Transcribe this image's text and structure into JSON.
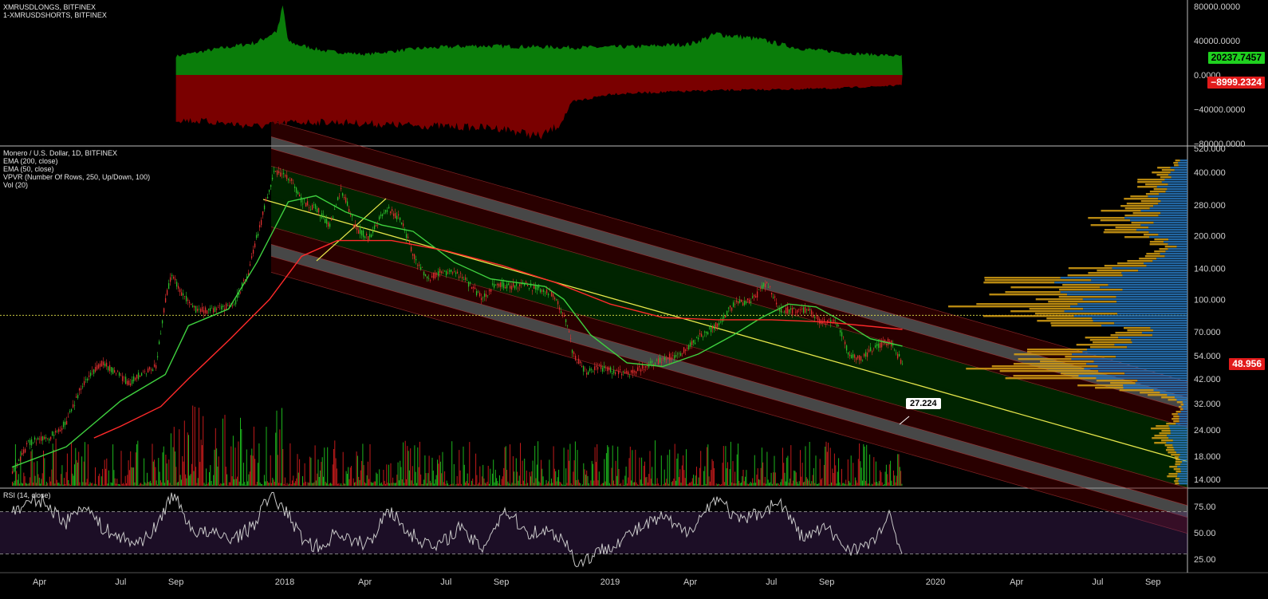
{
  "chart_data": [
    {
      "type": "area",
      "legend": [
        "XMRUSDLONGS, BITFINEX",
        "1-XMRUSDSHORTS, BITFINEX"
      ],
      "y_ticks": [
        "80000.0000",
        "40000.0000",
        "0.0000",
        "−40000.0000",
        "−80000.0000"
      ],
      "ylim": [
        -80000,
        80000
      ],
      "series": [
        {
          "name": "XMRUSDLONGS, BITFINEX",
          "color": "#0a7d0a",
          "last": "20237.7457",
          "x": [
            "2017-09-01",
            "2017-10-15",
            "2017-12-01",
            "2017-12-24",
            "2017-12-30",
            "2018-01-05",
            "2018-02-15",
            "2018-04-01",
            "2018-06-01",
            "2018-08-01",
            "2018-10-01",
            "2018-12-01",
            "2019-02-01",
            "2019-04-01",
            "2019-05-01",
            "2019-06-15",
            "2019-08-01",
            "2019-10-01",
            "2019-11-25"
          ],
          "values": [
            22000,
            30000,
            38000,
            52000,
            80000,
            38000,
            28000,
            24000,
            31000,
            34000,
            33000,
            32000,
            33000,
            36000,
            48000,
            42000,
            31000,
            25000,
            22000
          ]
        },
        {
          "name": "1-XMRUSDSHORTS, BITFINEX",
          "color": "#7a0000",
          "last": "−8999.2324",
          "x": [
            "2017-09-01",
            "2017-10-15",
            "2017-12-01",
            "2018-01-15",
            "2018-03-01",
            "2018-05-01",
            "2018-07-01",
            "2018-09-01",
            "2018-10-15",
            "2018-11-05",
            "2018-11-20",
            "2019-01-01",
            "2019-03-01",
            "2019-05-01",
            "2019-07-01",
            "2019-09-01",
            "2019-11-25"
          ],
          "values": [
            -52000,
            -55000,
            -60000,
            -55000,
            -55000,
            -58000,
            -60000,
            -62000,
            -72000,
            -58000,
            -32000,
            -22000,
            -20000,
            -18000,
            -17000,
            -16000,
            -12000
          ]
        }
      ]
    },
    {
      "type": "line",
      "title": "Monero / U.S. Dollar, 1D, BITFINEX",
      "legend": [
        "EMA (200, close)",
        "EMA (50, close)",
        "VPVR (Number Of Rows, 250, Up/Down, 100)",
        "Vol (20)"
      ],
      "y_scale": "log",
      "y_ticks": [
        "520.000",
        "400.000",
        "280.000",
        "200.000",
        "140.000",
        "100.000",
        "70.000",
        "54.000",
        "42.000",
        "32.000",
        "24.000",
        "18.000",
        "14.000"
      ],
      "x_ticks": [
        "Apr",
        "Jul",
        "Sep",
        "2018",
        "Apr",
        "Jul",
        "Sep",
        "2019",
        "Apr",
        "Jul",
        "Sep",
        "2020",
        "Apr",
        "Jul",
        "Sep"
      ],
      "x_tick_dates": [
        "2017-04-01",
        "2017-07-01",
        "2017-09-01",
        "2018-01-01",
        "2018-04-01",
        "2018-07-01",
        "2018-09-01",
        "2019-01-01",
        "2019-04-01",
        "2019-07-01",
        "2019-09-01",
        "2020-01-01",
        "2020-04-01",
        "2020-07-01",
        "2020-09-01"
      ],
      "last_price": "48.956",
      "horizontal_level": 84,
      "pitchfork_callout": "27.224",
      "price": {
        "x": [
          "2017-03-01",
          "2017-03-20",
          "2017-04-10",
          "2017-05-01",
          "2017-05-20",
          "2017-06-10",
          "2017-06-25",
          "2017-07-10",
          "2017-07-25",
          "2017-08-10",
          "2017-08-26",
          "2017-09-05",
          "2017-09-20",
          "2017-10-05",
          "2017-10-20",
          "2017-11-05",
          "2017-11-20",
          "2017-12-05",
          "2017-12-20",
          "2018-01-05",
          "2018-01-20",
          "2018-02-05",
          "2018-02-20",
          "2018-03-05",
          "2018-03-20",
          "2018-04-05",
          "2018-04-25",
          "2018-05-10",
          "2018-05-25",
          "2018-06-10",
          "2018-06-25",
          "2018-07-10",
          "2018-07-25",
          "2018-08-10",
          "2018-08-25",
          "2018-09-10",
          "2018-09-25",
          "2018-10-10",
          "2018-10-25",
          "2018-11-10",
          "2018-11-20",
          "2018-12-05",
          "2018-12-15",
          "2019-01-01",
          "2019-01-20",
          "2019-02-10",
          "2019-03-01",
          "2019-03-20",
          "2019-04-10",
          "2019-05-01",
          "2019-05-20",
          "2019-06-10",
          "2019-06-25",
          "2019-07-10",
          "2019-07-25",
          "2019-08-10",
          "2019-08-25",
          "2019-09-10",
          "2019-09-25",
          "2019-10-10",
          "2019-10-25",
          "2019-11-10",
          "2019-11-25"
        ],
        "y": [
          15,
          21,
          22,
          26,
          40,
          50,
          45,
          40,
          45,
          48,
          130,
          110,
          90,
          88,
          90,
          95,
          130,
          230,
          400,
          380,
          290,
          270,
          220,
          330,
          220,
          195,
          270,
          240,
          160,
          125,
          135,
          135,
          120,
          100,
          120,
          115,
          118,
          112,
          108,
          84,
          55,
          44,
          48,
          46,
          44,
          48,
          52,
          55,
          66,
          76,
          95,
          100,
          120,
          90,
          88,
          90,
          78,
          80,
          55,
          52,
          60,
          63,
          49
        ]
      },
      "series": [
        {
          "name": "EMA (50, close)",
          "color": "#3fd13f",
          "x": [
            "2017-03-01",
            "2017-05-01",
            "2017-07-01",
            "2017-08-20",
            "2017-09-15",
            "2017-10-30",
            "2017-12-01",
            "2018-01-05",
            "2018-02-05",
            "2018-03-10",
            "2018-04-20",
            "2018-05-25",
            "2018-07-10",
            "2018-08-20",
            "2018-10-20",
            "2018-11-10",
            "2018-12-10",
            "2019-01-20",
            "2019-03-01",
            "2019-04-10",
            "2019-05-20",
            "2019-06-20",
            "2019-07-20",
            "2019-08-20",
            "2019-09-20",
            "2019-10-20",
            "2019-11-25"
          ],
          "y": [
            16,
            20,
            33,
            44,
            75,
            90,
            150,
            290,
            310,
            260,
            225,
            210,
            150,
            125,
            115,
            100,
            68,
            50,
            48,
            55,
            68,
            82,
            95,
            92,
            78,
            65,
            60
          ]
        },
        {
          "name": "EMA (200, close)",
          "color": "#ff2a2a",
          "x": [
            "2017-06-01",
            "2017-07-01",
            "2017-08-15",
            "2017-09-15",
            "2017-11-01",
            "2017-12-15",
            "2018-01-20",
            "2018-03-01",
            "2018-05-01",
            "2018-07-01",
            "2018-09-01",
            "2018-11-01",
            "2019-01-01",
            "2019-03-01",
            "2019-05-01",
            "2019-07-01",
            "2019-09-01",
            "2019-11-25"
          ],
          "y": [
            22,
            25,
            31,
            42,
            65,
            100,
            160,
            190,
            190,
            170,
            145,
            120,
            95,
            82,
            80,
            80,
            78,
            72
          ]
        }
      ]
    },
    {
      "type": "line",
      "title": "RSI (14, close)",
      "y_ticks": [
        "75.00",
        "50.00",
        "25.00"
      ],
      "ylim": [
        15,
        90
      ],
      "band": [
        30,
        70
      ],
      "series": [
        {
          "name": "RSI (14, close)",
          "color": "#c8c8c8",
          "x": [
            "2017-03-01",
            "2017-04-01",
            "2017-05-01",
            "2017-05-20",
            "2017-06-10",
            "2017-07-01",
            "2017-07-20",
            "2017-08-10",
            "2017-08-28",
            "2017-09-20",
            "2017-10-15",
            "2017-11-05",
            "2017-11-25",
            "2017-12-15",
            "2017-12-30",
            "2018-01-20",
            "2018-02-10",
            "2018-03-01",
            "2018-03-20",
            "2018-04-10",
            "2018-04-25",
            "2018-05-20",
            "2018-06-20",
            "2018-07-15",
            "2018-08-10",
            "2018-09-05",
            "2018-09-30",
            "2018-10-20",
            "2018-11-10",
            "2018-11-25",
            "2018-12-15",
            "2019-01-10",
            "2019-02-05",
            "2019-03-01",
            "2019-03-25",
            "2019-04-10",
            "2019-05-01",
            "2019-05-25",
            "2019-06-20",
            "2019-07-10",
            "2019-08-05",
            "2019-08-30",
            "2019-09-25",
            "2019-10-20",
            "2019-11-10",
            "2019-11-25"
          ],
          "y": [
            70,
            82,
            60,
            78,
            55,
            45,
            40,
            55,
            88,
            52,
            48,
            45,
            55,
            85,
            75,
            45,
            35,
            52,
            40,
            42,
            75,
            50,
            35,
            55,
            35,
            72,
            50,
            52,
            45,
            20,
            30,
            42,
            55,
            65,
            50,
            62,
            85,
            60,
            70,
            80,
            45,
            55,
            35,
            38,
            65,
            28
          ]
        }
      ]
    }
  ]
}
